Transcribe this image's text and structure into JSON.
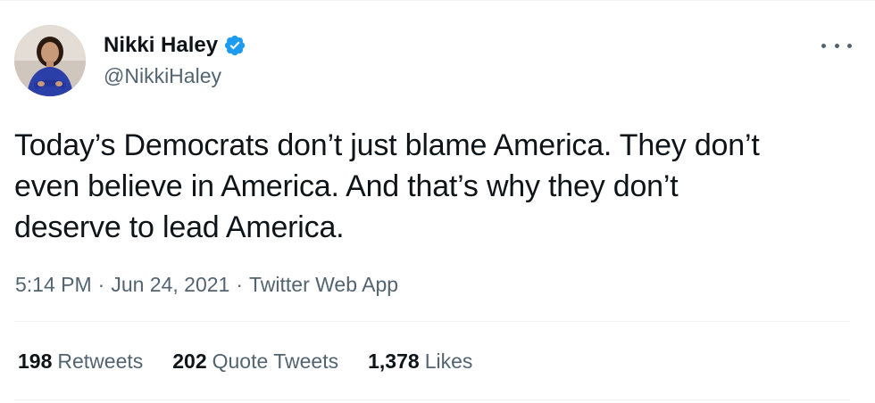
{
  "author": {
    "display_name": "Nikki Haley",
    "handle": "@NikkiHaley",
    "verified": true,
    "verified_color": "#1d9bf0"
  },
  "tweet": {
    "text": "Today’s Democrats don’t just blame America. They don’t\neven believe in America. And that’s why they don’t\ndeserve to lead America."
  },
  "meta": {
    "time": "5:14 PM",
    "separator": "·",
    "date": "Jun 24, 2021",
    "source": "Twitter Web App"
  },
  "stats": {
    "retweets": {
      "count": "198",
      "label": "Retweets"
    },
    "quote_tweets": {
      "count": "202",
      "label": "Quote Tweets"
    },
    "likes": {
      "count": "1,378",
      "label": "Likes"
    }
  },
  "icons": {
    "verified": "verified-badge-icon",
    "more": "more-options-icon"
  }
}
